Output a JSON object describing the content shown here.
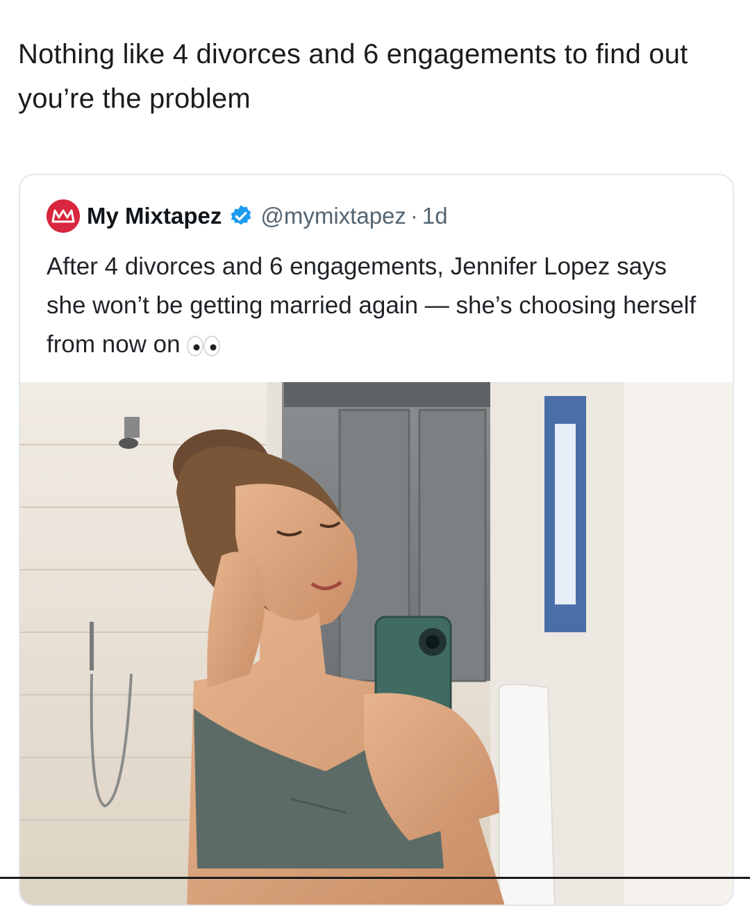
{
  "post": {
    "text": "Nothing like 4 divorces and 6 engagements to find out you’re the problem"
  },
  "quoted_tweet": {
    "display_name": "My Mixtapez",
    "handle": "@mymixtapez",
    "separator": "·",
    "time": "1d",
    "body": "After 4 divorces and 6 engagements, Jennifer Lopez says she won’t be getting married again — she’s choosing herself from now on",
    "avatar_color": "#d7263d",
    "verified_color": "#1d9bf0",
    "emoji_icon": "eyes-emoji"
  },
  "media": {
    "description_icon": "photo"
  }
}
